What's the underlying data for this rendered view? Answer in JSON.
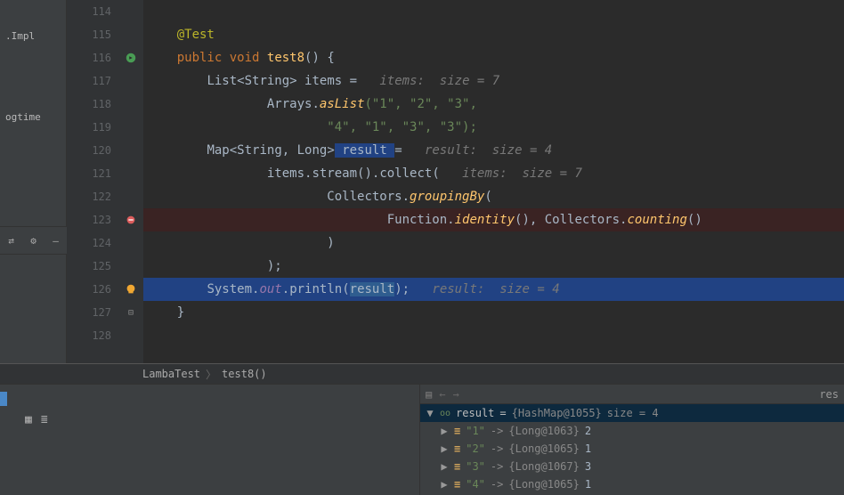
{
  "left_panel": {
    "item1": ".Impl",
    "item2": "ogtime"
  },
  "lines": {
    "114": "114",
    "115": "115",
    "116": "116",
    "117": "117",
    "118": "118",
    "119": "119",
    "120": "120",
    "121": "121",
    "122": "122",
    "123": "123",
    "124": "124",
    "125": "125",
    "126": "126",
    "127": "127",
    "128": "128"
  },
  "code": {
    "annotation": "@Test",
    "public": "public ",
    "void": "void ",
    "method": "test8",
    "brace_open": "() {",
    "list": "List",
    "lt": "<",
    "gt": ">",
    "string": "String",
    "sp_items": " items ",
    "eq": "=",
    "hint_items7": "items:  size = 7",
    "arrays": "Arrays",
    "dot": ".",
    "aslist": "asList",
    "aslist_args1": "(\"1\", \"2\", \"3\",",
    "aslist_args2": "\"4\", \"1\", \"3\", \"3\");",
    "map": "Map",
    "comma_sp": ", ",
    "long": "Long",
    "sp_result": " result ",
    "hint_result4": "result:  size = 4",
    "stream": "stream",
    "collect": "collect",
    "paren_o": "(",
    "paren_c": ")",
    "collectors": "Collectors",
    "groupingby": "groupingBy",
    "function": "Function",
    "identity": "identity",
    "counting": "counting",
    "close_paren_sc": ");",
    "system": "System",
    "out": "out",
    "println": "println",
    "res_arg": "result",
    "sc": ";",
    "brace_close": "}"
  },
  "breadcrumb": {
    "a": "LambaTest",
    "b": "test8()"
  },
  "debugger": {
    "res_label": "res",
    "root_name": "result",
    "root_eq": " = ",
    "root_type": "{HashMap@1055}",
    "root_size": "  size = 4",
    "entries": [
      {
        "k": "\"1\"",
        "v": "{Long@1063}",
        "n": "2"
      },
      {
        "k": "\"2\"",
        "v": "{Long@1065}",
        "n": "1"
      },
      {
        "k": "\"3\"",
        "v": "{Long@1067}",
        "n": "3"
      },
      {
        "k": "\"4\"",
        "v": "{Long@1065}",
        "n": "1"
      }
    ]
  }
}
